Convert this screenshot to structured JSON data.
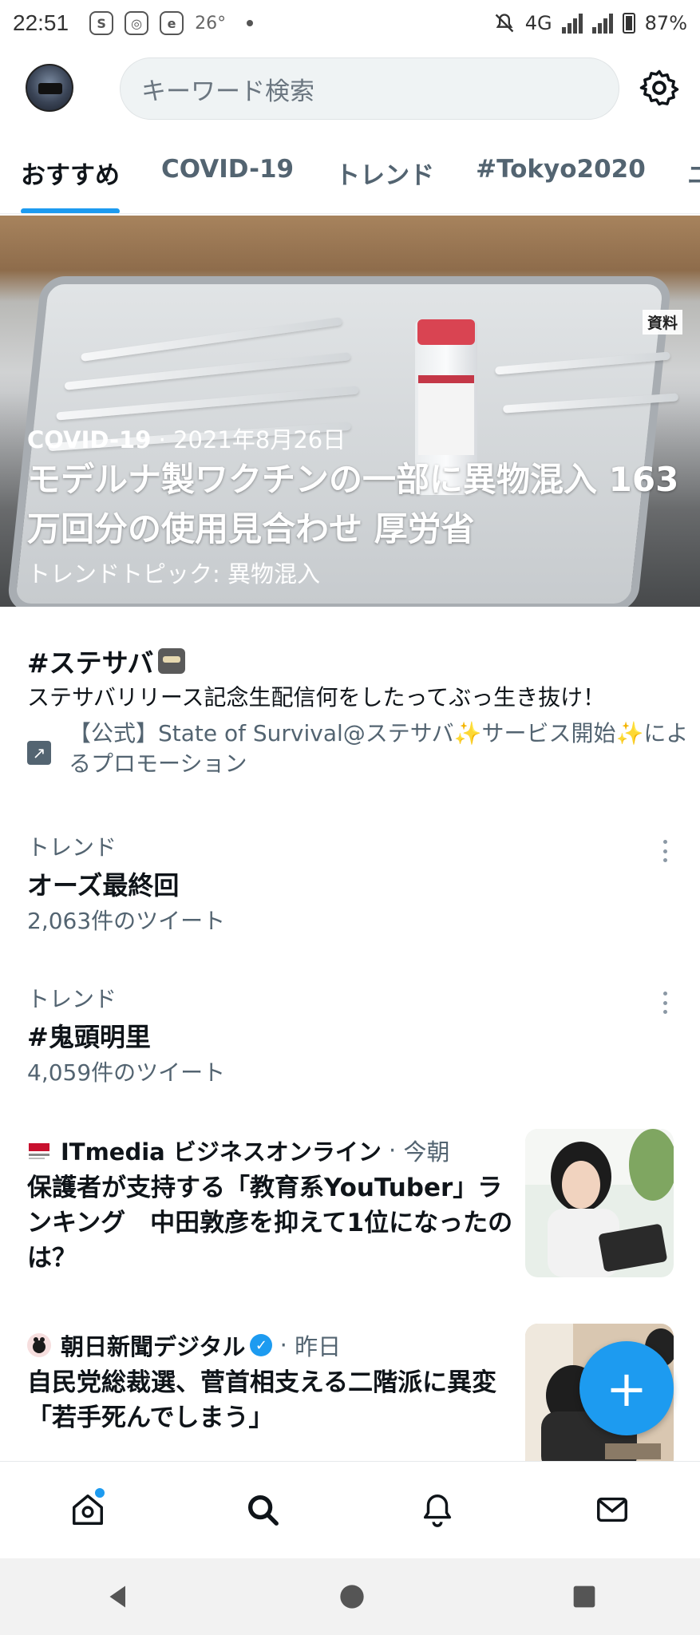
{
  "status_bar": {
    "time": "22:51",
    "icons": [
      "sf-badge-icon",
      "instagram-icon",
      "e-app-icon"
    ],
    "temperature": "26°",
    "network": "4G",
    "battery": "87%"
  },
  "header": {
    "search_placeholder": "キーワード検索"
  },
  "tabs": [
    {
      "label": "おすすめ",
      "active": true
    },
    {
      "label": "COVID-19",
      "active": false
    },
    {
      "label": "トレンド",
      "active": false
    },
    {
      "label": "#Tokyo2020",
      "active": false
    },
    {
      "label": "ニ",
      "active": false
    }
  ],
  "hero": {
    "badge": "資料",
    "category": "COVID-19",
    "date": "2021年8月26日",
    "title": "モデルナ製ワクチンの一部に異物混入 163万回分の使用見合わせ 厚労省",
    "topic": "トレンドトピック: 異物混入"
  },
  "promoted": {
    "hashtag": "#ステサバ",
    "description": "ステサバリリース記念生配信何をしたってぶっ生き抜け！",
    "promoted_by": "【公式】State of Survival@ステサバ✨サービス開始✨によるプロモーション"
  },
  "trends": [
    {
      "category": "トレンド",
      "name": "オーズ最終回",
      "count": "2,063件のツイート"
    },
    {
      "category": "トレンド",
      "name": "#鬼頭明里",
      "count": "4,059件のツイート"
    }
  ],
  "news": [
    {
      "source": "ITmedia ビジネスオンライン",
      "time": "今朝",
      "title": "保護者が支持する「教育系YouTuber」ランキング　中田敦彦を抑えて1位になったのは？",
      "verified": false
    },
    {
      "source": "朝日新聞デジタル",
      "time": "昨日",
      "title": "自民党総裁選、菅首相支える二階派に異変　「若手死んでしまう」",
      "verified": true
    }
  ],
  "fab": {
    "label": "+"
  },
  "colors": {
    "accent": "#1d9bf0",
    "text": "#0f1419",
    "muted": "#536471"
  }
}
